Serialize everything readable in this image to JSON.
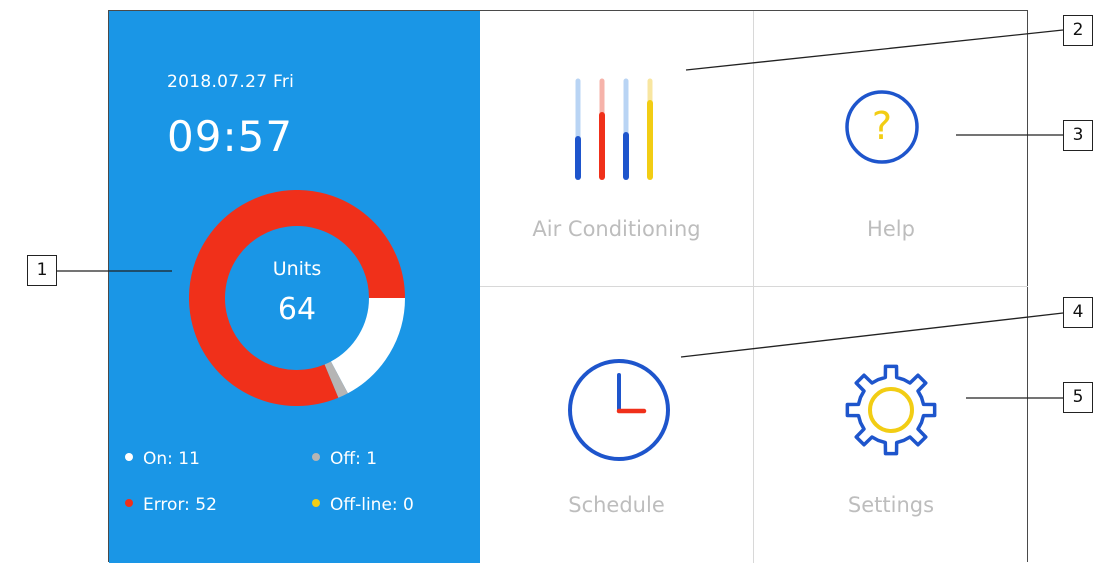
{
  "status_panel": {
    "date": "2018.07.27  Fri",
    "time": "09:57",
    "units_label": "Units",
    "units_total": "64",
    "legend": {
      "on": "On: 11",
      "off": "Off: 1",
      "error": "Error: 52",
      "offline": "Off-line: 0"
    },
    "counts": {
      "on": 11,
      "off": 1,
      "error": 52,
      "offline": 0
    },
    "colors": {
      "panel": "#1a96e6",
      "on": "#ffffff",
      "off": "#b5b5b5",
      "error": "#f0301a",
      "offline": "#f2cd14"
    }
  },
  "menu": {
    "air_conditioning": "Air Conditioning",
    "help": "Help",
    "schedule": "Schedule",
    "settings": "Settings"
  },
  "icons": {
    "air_conditioning": "slider-bars-icon",
    "help": "question-mark-icon",
    "schedule": "clock-icon",
    "settings": "gear-icon"
  },
  "callouts": [
    "1",
    "2",
    "3",
    "4",
    "5"
  ]
}
